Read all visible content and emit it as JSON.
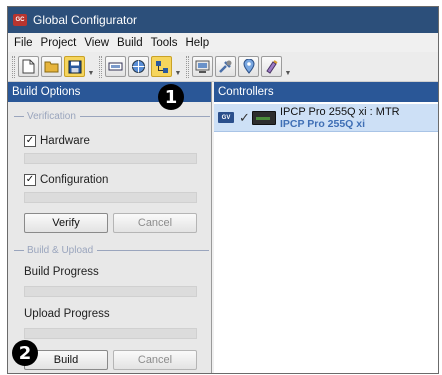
{
  "window": {
    "title": "Global Configurator",
    "app_icon_text": "GC"
  },
  "menu": [
    "File",
    "Project",
    "View",
    "Build",
    "Tools",
    "Help"
  ],
  "toolbar": {
    "group1": [
      "new-file-icon",
      "open-folder-icon",
      "save-icon"
    ],
    "group1_active_index": 2,
    "group2": [
      "device-view-icon",
      "network-view-icon",
      "layout-view-icon"
    ],
    "group3": [
      "build-icon",
      "tools-icon",
      "marker-icon",
      "settings-icon"
    ]
  },
  "build_options": {
    "header": "Build Options",
    "verification": {
      "label": "Verification",
      "hardware": {
        "label": "Hardware",
        "checked": true
      },
      "configuration": {
        "label": "Configuration",
        "checked": true
      },
      "verify_button": "Verify",
      "cancel_button": "Cancel"
    },
    "build_upload": {
      "label": "Build & Upload",
      "build_progress_label": "Build Progress",
      "upload_progress_label": "Upload Progress",
      "build_button": "Build",
      "cancel_button": "Cancel"
    }
  },
  "controllers": {
    "header": "Controllers",
    "items": [
      {
        "badge": "GV",
        "checked": true,
        "name": "IPCP Pro 255Q xi : MTR",
        "model": "IPCP Pro 255Q xi"
      }
    ]
  },
  "callouts": [
    "1",
    "2"
  ],
  "colors": {
    "title_bar": "#2c4f7a",
    "panel_header": "#2a5797",
    "selected_row": "#cde0f6",
    "active_tool": "#f6d55c"
  }
}
